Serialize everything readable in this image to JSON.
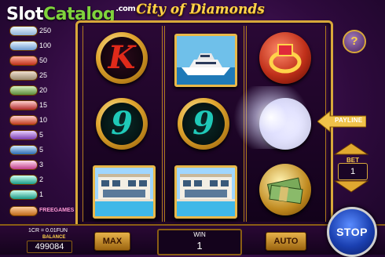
{
  "watermark": {
    "part1": "Slot",
    "part2": "Catalog",
    "suffix": ".com"
  },
  "title": "City of Diamonds",
  "paytable": [
    {
      "value": "250"
    },
    {
      "value": "100"
    },
    {
      "value": "50"
    },
    {
      "value": "25"
    },
    {
      "value": "20"
    },
    {
      "value": "15"
    },
    {
      "value": "10"
    },
    {
      "value": "5"
    },
    {
      "value": "5"
    },
    {
      "value": "3"
    },
    {
      "value": "2"
    },
    {
      "value": "1"
    },
    {
      "value": "FREEGAMES"
    }
  ],
  "reels": [
    [
      {
        "symbol": "K",
        "color": "#e02a1a"
      },
      {
        "symbol": "9",
        "color": "#1fc9b8"
      },
      {
        "symbol": "villa"
      }
    ],
    [
      {
        "symbol": "yacht"
      },
      {
        "symbol": "9",
        "color": "#1fc9b8"
      },
      {
        "symbol": "villa"
      }
    ],
    [
      {
        "symbol": "ring"
      },
      {
        "symbol": "diamond-sparkle"
      },
      {
        "symbol": "money"
      }
    ]
  ],
  "controls": {
    "help": "?",
    "payline": "PAYLINE",
    "bet_label": "BET",
    "bet_value": "1",
    "stop": "STOP",
    "max": "MAX",
    "auto": "AUTO"
  },
  "footer": {
    "rate": "1CR = 0.01FUN",
    "balance_label": "BALANCE",
    "balance": "499084",
    "win_label": "WIN",
    "win": "1"
  },
  "colors": {
    "gold": "#d8a83a",
    "purple": "#2e0a3d",
    "teal": "#1fc9b8"
  }
}
